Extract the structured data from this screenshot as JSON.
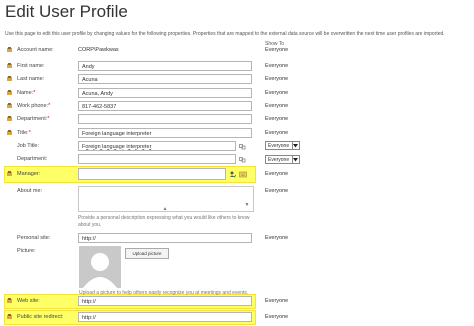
{
  "page": {
    "title": "Edit User Profile",
    "description": "Use this page to edit this user profile by changing values for the following properties. Properties that are mapped to the external data source will be overwritten the next time user profiles are imported.",
    "show_to_header": "Show To"
  },
  "fields": {
    "account_name": {
      "label": "Account name:",
      "value": "CORP\\Pawkwas",
      "show_to": "Everyone"
    },
    "first_name": {
      "label": "First name:",
      "value": "Andy",
      "show_to": "Everyone"
    },
    "last_name": {
      "label": "Last name:",
      "value": "Acuna",
      "show_to": "Everyone"
    },
    "name": {
      "label": "Name:",
      "required": "*",
      "value": "Acuna, Andy",
      "show_to": "Everyone"
    },
    "work_phone": {
      "label": "Work phone:",
      "required": "*",
      "value": "817-462-5837",
      "show_to": "Everyone"
    },
    "department": {
      "label": "Department:",
      "required": "*",
      "value": "",
      "show_to": "Everyone"
    },
    "title": {
      "label": "Title:",
      "required": "*",
      "value": "Foreign language interpreter",
      "show_to": "Everyone"
    },
    "job_title": {
      "label": "Job Title:",
      "value": "Foreign language interpreter",
      "show_to_select": "Everyone"
    },
    "department2": {
      "label": "Department:",
      "value": "",
      "show_to_select": "Everyone"
    },
    "manager": {
      "label": "Manager:",
      "value": "",
      "show_to": "Everyone"
    },
    "about_me": {
      "label": "About me:",
      "hint": "Provide a personal description expressing what you would like others to know about you.",
      "show_to": "Everyone"
    },
    "personal_site": {
      "label": "Personal site:",
      "value": "http://",
      "show_to": "Everyone"
    },
    "picture": {
      "label": "Picture:",
      "button": "Upload picture",
      "hint": "Upload a picture to help others easily recognize you at meetings and events.",
      "show_to": "Everyone"
    },
    "web_site": {
      "label": "Web site:",
      "value": "http://",
      "show_to": "Everyone"
    },
    "public_site_redirect": {
      "label": "Public site redirect:",
      "value": "http://",
      "show_to": "Everyone"
    }
  },
  "colors": {
    "highlight": "#ffff66",
    "highlight_border": "#f5e33a"
  },
  "icons": {
    "property": "user-property-icon",
    "validate": "check-names-icon",
    "browse": "address-book-icon",
    "managed_metadata": "tag-icon"
  }
}
